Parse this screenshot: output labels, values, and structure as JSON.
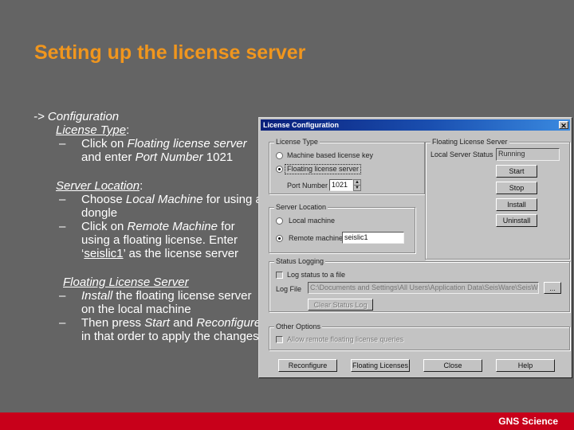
{
  "slide": {
    "title": "Setting up the license server",
    "heading": "-> Configuration",
    "sections": [
      {
        "label": "License Type",
        "suffix": ":",
        "bullets": [
          {
            "dash": "–",
            "parts": [
              {
                "text": "Click on ",
                "style": ""
              },
              {
                "text": "Floating license server",
                "style": "i"
              },
              {
                "text": " and enter ",
                "style": ""
              },
              {
                "text": "Port Number",
                "style": "i"
              },
              {
                "text": " 1021",
                "style": ""
              }
            ]
          }
        ]
      },
      {
        "label": "Server Location",
        "suffix": ":",
        "bullets": [
          {
            "dash": "–",
            "parts": [
              {
                "text": "Choose ",
                "style": ""
              },
              {
                "text": "Local Machine",
                "style": "i"
              },
              {
                "text": " for using a dongle",
                "style": ""
              }
            ]
          },
          {
            "dash": "–",
            "parts": [
              {
                "text": "Click on ",
                "style": ""
              },
              {
                "text": "Remote Machine",
                "style": "i"
              },
              {
                "text": " for using a floating license. Enter ‘",
                "style": ""
              },
              {
                "text": "seislic1",
                "style": "u"
              },
              {
                "text": "’ as the license server",
                "style": ""
              }
            ]
          }
        ]
      },
      {
        "label": "Floating License Server",
        "suffix": "",
        "bullets": [
          {
            "dash": "–",
            "parts": [
              {
                "text": "Install",
                "style": "i"
              },
              {
                "text": " the floating license server on the local machine",
                "style": ""
              }
            ]
          },
          {
            "dash": "–",
            "parts": [
              {
                "text": "Then press ",
                "style": ""
              },
              {
                "text": "Start",
                "style": "i"
              },
              {
                "text": " and ",
                "style": ""
              },
              {
                "text": "Reconfigure",
                "style": "i"
              },
              {
                "text": " in that order to apply the changes.",
                "style": ""
              }
            ]
          }
        ]
      }
    ]
  },
  "dialog": {
    "title": "License Configuration",
    "close_icon": "close-icon",
    "license_type": {
      "group_label": "License Type",
      "options": [
        {
          "label": "Machine based license key",
          "selected": false
        },
        {
          "label": "Floating license server",
          "selected": true
        }
      ],
      "port_label": "Port Number",
      "port_value": "1021"
    },
    "floating_server": {
      "group_label": "Floating License Server",
      "status_label": "Local Server Status",
      "status_value": "Running",
      "buttons": [
        "Start",
        "Stop",
        "Install",
        "Uninstall"
      ]
    },
    "server_location": {
      "group_label": "Server Location",
      "options": [
        {
          "label": "Local machine",
          "selected": false
        },
        {
          "label": "Remote machine",
          "selected": true
        }
      ],
      "remote_value": "seislic1"
    },
    "status_logging": {
      "group_label": "Status Logging",
      "checkbox_label": "Log status to a file",
      "checked": false,
      "log_file_label": "Log File",
      "log_file_value": "C:\\Documents and Settings\\All Users\\Application Data\\SeisWare\\SeisWare\\License",
      "browse_label": "...",
      "clear_button": "Clear Status Log"
    },
    "other_options": {
      "group_label": "Other Options",
      "checkbox_label": "Allow remote floating license queries",
      "checked": false
    },
    "footer_buttons": [
      "Reconfigure",
      "Floating Licenses",
      "Close",
      "Help"
    ]
  },
  "footer": {
    "brand": "GNS Science",
    "color": "#c8001a"
  },
  "colors": {
    "background": "#646464",
    "title": "#f0961e",
    "dialog": "#c3c3c3"
  }
}
